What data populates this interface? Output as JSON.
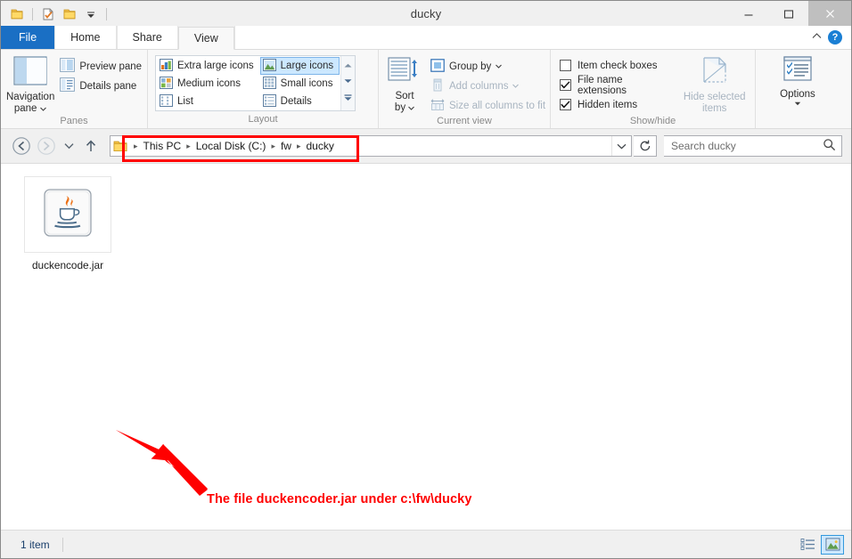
{
  "window": {
    "title": "ducky",
    "minimize_label": "–",
    "maximize_label": "❑",
    "close_label": "×"
  },
  "quick_access": {
    "items": [
      {
        "name": "folder-icon",
        "label": ""
      },
      {
        "name": "properties-icon",
        "label": ""
      },
      {
        "name": "new-folder-icon",
        "label": ""
      },
      {
        "name": "customize-chevron-icon",
        "label": ""
      }
    ]
  },
  "tabs": [
    {
      "label": "File",
      "active": false,
      "is_file": true
    },
    {
      "label": "Home",
      "active": false
    },
    {
      "label": "Share",
      "active": false
    },
    {
      "label": "View",
      "active": true
    }
  ],
  "ribbon_right": {
    "collapse_label": "˄",
    "help_label": "?"
  },
  "ribbon": {
    "panes": {
      "group_label": "Panes",
      "navigation_pane": "Navigation\npane",
      "navigation_pane_line1": "Navigation",
      "navigation_pane_line2": "pane",
      "preview_pane": "Preview pane",
      "details_pane": "Details pane"
    },
    "layout": {
      "group_label": "Layout",
      "items": [
        {
          "label": "Extra large icons",
          "selected": false
        },
        {
          "label": "Large icons",
          "selected": true
        },
        {
          "label": "Medium icons",
          "selected": false
        },
        {
          "label": "Small icons",
          "selected": false
        },
        {
          "label": "List",
          "selected": false
        },
        {
          "label": "Details",
          "selected": false
        }
      ],
      "scroll_up": "▲",
      "scroll_down": "▼",
      "scroll_more": "▾"
    },
    "current_view": {
      "group_label": "Current view",
      "sort_by_line1": "Sort",
      "sort_by_line2": "by",
      "group_by": "Group by",
      "add_columns": "Add columns",
      "size_all_columns": "Size all columns to fit"
    },
    "show_hide": {
      "group_label": "Show/hide",
      "item_check_boxes": {
        "label": "Item check boxes",
        "checked": false
      },
      "file_name_extensions": {
        "label": "File name extensions",
        "checked": true
      },
      "hidden_items": {
        "label": "Hidden items",
        "checked": true
      },
      "hide_selected_line1": "Hide selected",
      "hide_selected_line2": "items"
    },
    "options": {
      "label": "Options"
    }
  },
  "navigation": {
    "back_label": "←",
    "forward_label": "→",
    "recent_label": "˅",
    "up_label": "↑",
    "breadcrumbs": [
      "This PC",
      "Local Disk (C:)",
      "fw",
      "ducky"
    ],
    "breadcrumb_separator": "▸",
    "dropdown_label": "˅",
    "refresh_label": "↻"
  },
  "search": {
    "placeholder": "Search ducky",
    "value": "",
    "icon": "search-icon"
  },
  "files": [
    {
      "name": "duckencode.jar",
      "icon": "java-jar-icon"
    }
  ],
  "annotations": {
    "callout_text": "The file duckencoder.jar under c:\\fw\\ducky",
    "color": "#ff0000"
  },
  "statusbar": {
    "item_count": "1 item",
    "view_details_icon": "details-view-icon",
    "view_large_icons_icon": "large-icons-view-icon",
    "active_view": "large-icons-view-icon"
  }
}
